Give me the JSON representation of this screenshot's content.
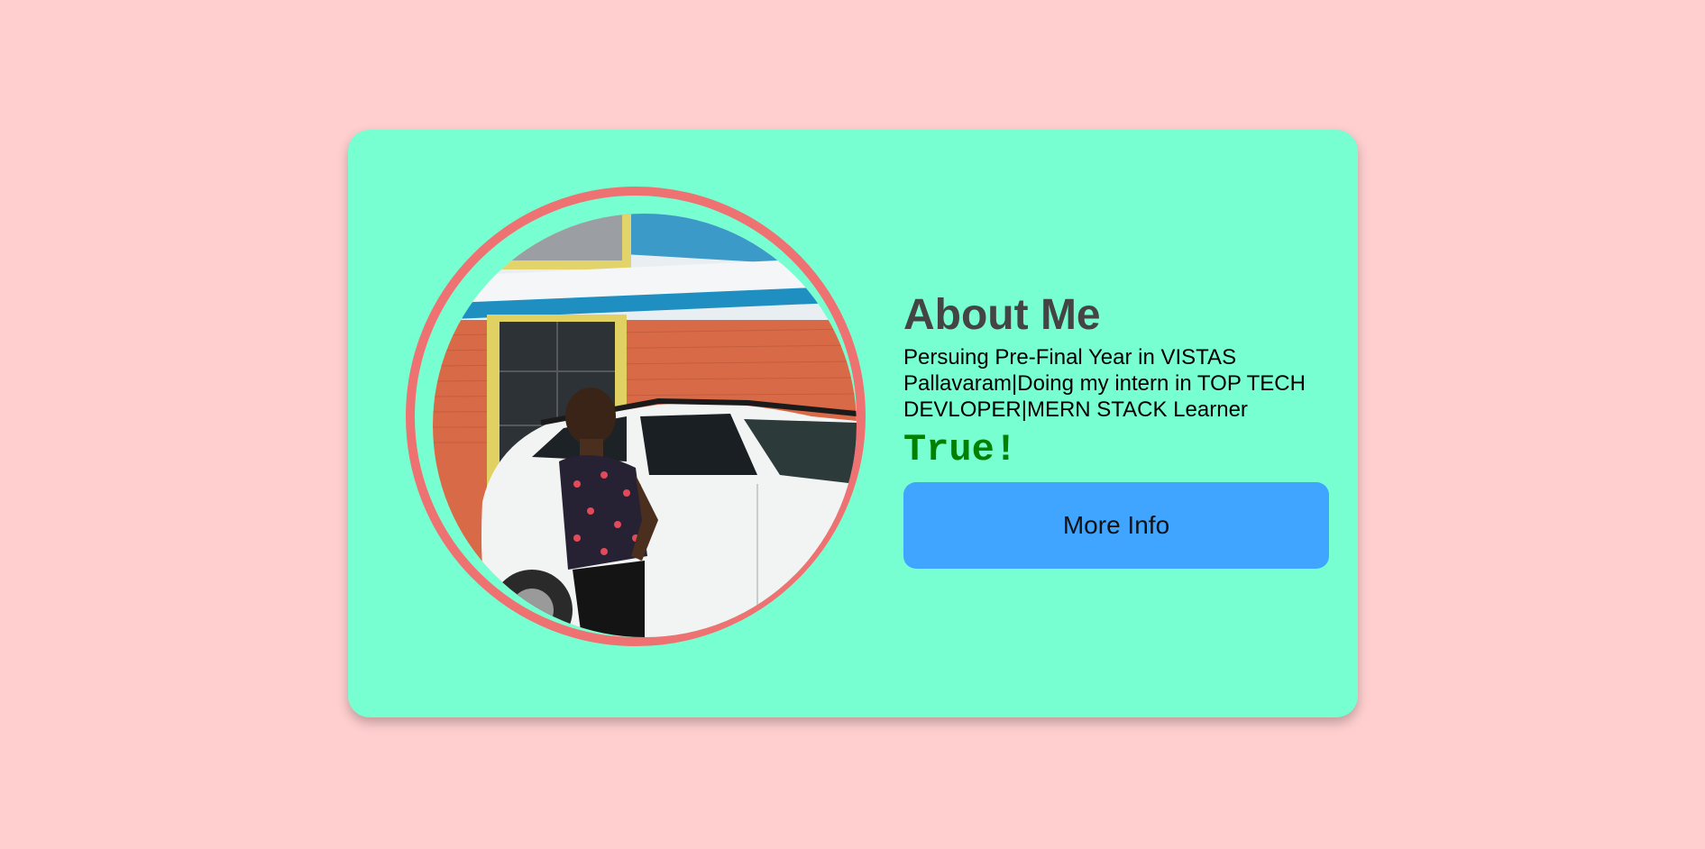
{
  "profile": {
    "title": "About Me",
    "bio": "Persuing Pre-Final Year in VISTAS Pallavaram|Doing my intern in TOP TECH DEVLOPER|MERN STACK Learner",
    "status": "True!",
    "button_label": "More Info",
    "photo": "profile-photo"
  },
  "colors": {
    "page_background": "#ffcfcf",
    "card_background": "#77ffd2",
    "photo_ring": "#ef7272",
    "status_text": "#008000",
    "button_background": "#3fa5ff",
    "title_text": "#444444"
  }
}
